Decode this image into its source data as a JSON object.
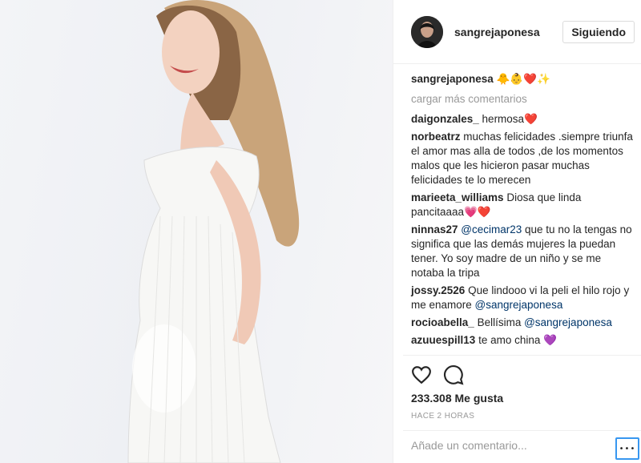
{
  "header": {
    "username": "sangrejaponesa",
    "follow_label": "Siguiendo"
  },
  "caption": {
    "user": "sangrejaponesa",
    "text": "🐥👶❤️✨"
  },
  "load_more_label": "cargar más comentarios",
  "comments": [
    {
      "user": "daigonzales_",
      "text": "hermosa❤️"
    },
    {
      "user": "norbeatrz",
      "text": "muchas felicidades .siempre triunfa el amor mas alla de todos ,de los momentos malos que les hicieron pasar muchas felicidades te lo merecen"
    },
    {
      "user": "marieeta_williams",
      "text": "Diosa que linda pancitaaaa💗❤️"
    },
    {
      "user": "ninnas27",
      "mention": "@cecimar23",
      "text": " que tu no la tengas no significa que las demás mujeres la puedan tener. Yo soy madre de un niño y se me notaba la tripa"
    },
    {
      "user": "jossy.2526",
      "text": "Que lindooo vi la peli el hilo rojo y me enamore ",
      "mention_after": "@sangrejaponesa"
    },
    {
      "user": "rocioabella_",
      "text": "Bellísima ",
      "mention_after": "@sangrejaponesa"
    },
    {
      "user": "azuuespill13",
      "text": "te amo china 💜"
    }
  ],
  "likes_label": "233.308 Me gusta",
  "time_label": "HACE 2 HORAS",
  "add_comment_placeholder": "Añade un comentario...",
  "more_label": "•••",
  "icons": {
    "like": "heart-outline-icon",
    "comment": "speech-bubble-icon",
    "more": "ellipsis-icon"
  },
  "colors": {
    "mention": "#003569",
    "more_border": "#3897f0",
    "muted": "#999999"
  }
}
